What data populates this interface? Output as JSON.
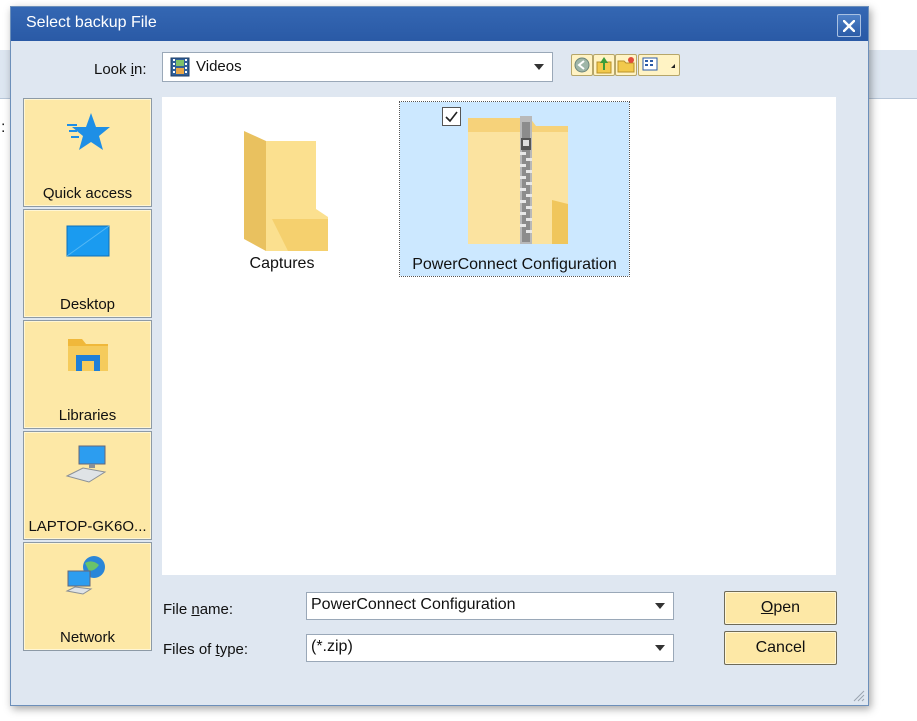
{
  "dialog": {
    "title": "Select backup File",
    "lookin_label_pre": "Look ",
    "lookin_label_key": "i",
    "lookin_label_post": "n:",
    "lookin_value": "Videos"
  },
  "places": [
    {
      "label": "Quick access",
      "icon": "star-icon"
    },
    {
      "label": "Desktop",
      "icon": "desktop-icon"
    },
    {
      "label": "Libraries",
      "icon": "libraries-icon"
    },
    {
      "label": "LAPTOP-GK6O...",
      "icon": "computer-icon"
    },
    {
      "label": "Network",
      "icon": "network-icon"
    }
  ],
  "files": [
    {
      "name": "Captures",
      "type": "folder-icon"
    },
    {
      "name": "PowerConnect Configuration",
      "type": "zip-folder-icon",
      "selected": true,
      "checked": true
    }
  ],
  "filename": {
    "label_pre": "File ",
    "label_key": "n",
    "label_post": "ame:",
    "value": "PowerConnect Configuration"
  },
  "filetype": {
    "label_pre": "Files of ",
    "label_key": "t",
    "label_post": "ype:",
    "value": "(*.zip)"
  },
  "buttons": {
    "open_key": "O",
    "open_rest": "pen",
    "cancel": "Cancel"
  },
  "colors": {
    "titlebar": "#2a5aa6",
    "place_bg": "#fde8a6",
    "selection": "#cce8ff"
  }
}
